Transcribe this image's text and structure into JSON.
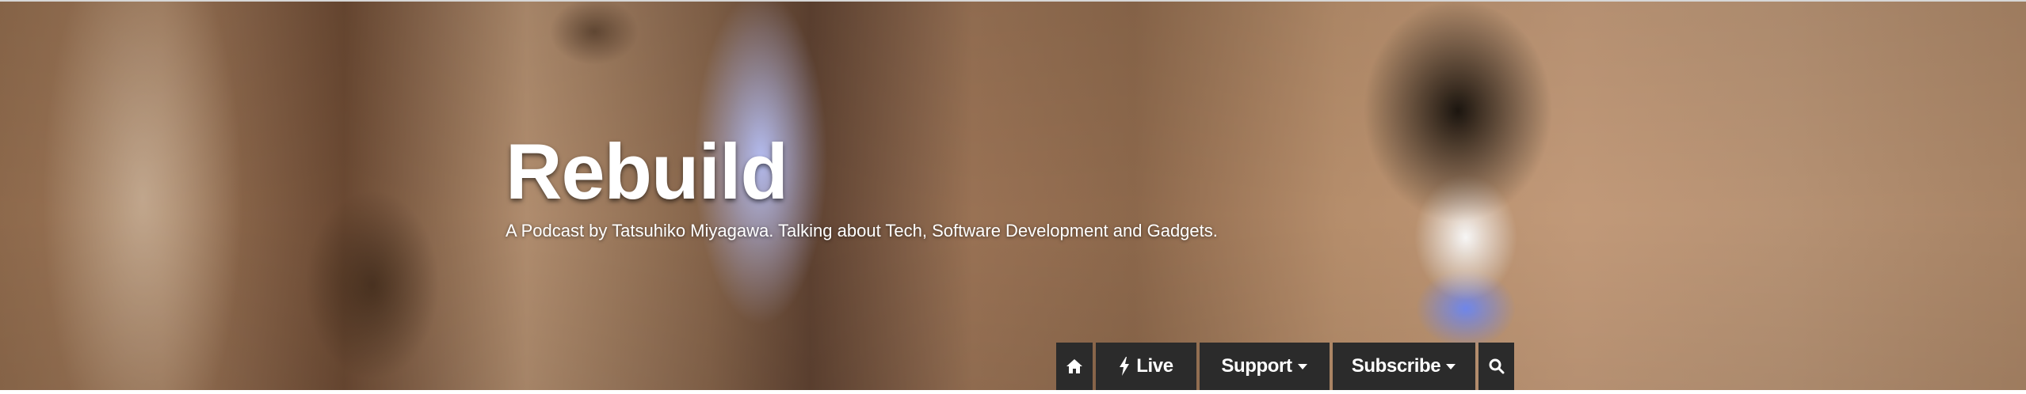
{
  "site": {
    "title": "Rebuild",
    "tagline": "A Podcast by Tatsuhiko Miyagawa. Talking about Tech, Software Development and Gadgets."
  },
  "nav": {
    "items": [
      {
        "icon": "home-icon",
        "label": ""
      },
      {
        "icon": "bolt-icon",
        "label": "Live"
      },
      {
        "icon": "caret-down-icon",
        "label": "Support"
      },
      {
        "icon": "caret-down-icon",
        "label": "Subscribe"
      },
      {
        "icon": "search-icon",
        "label": ""
      }
    ]
  },
  "colors": {
    "nav_background": "#2b2b2b",
    "text": "#ffffff"
  }
}
